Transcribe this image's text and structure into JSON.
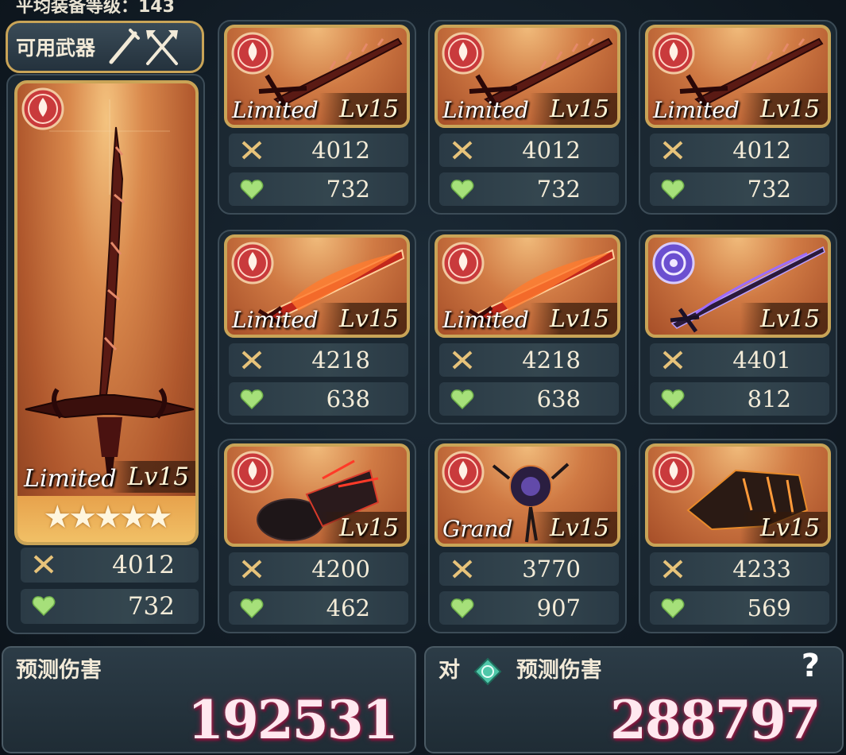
{
  "top_title": "平均装备等级：143",
  "header": {
    "label": "可用武器",
    "icons": [
      "sword-icon",
      "crossed-spears-icon"
    ]
  },
  "selected_weapon": {
    "tag": "Limited",
    "level": "Lv15",
    "stars": "★★★★★",
    "rarity_stars": 5,
    "attack": "4012",
    "hp": "732",
    "element": "fire"
  },
  "weapons": [
    {
      "tag": "Limited",
      "level": "Lv15",
      "attack": "4012",
      "hp": "732",
      "element": "fire",
      "art": "dark-spiked-sword"
    },
    {
      "tag": "Limited",
      "level": "Lv15",
      "attack": "4012",
      "hp": "732",
      "element": "fire",
      "art": "dark-spiked-sword"
    },
    {
      "tag": "Limited",
      "level": "Lv15",
      "attack": "4012",
      "hp": "732",
      "element": "fire",
      "art": "dark-spiked-sword"
    },
    {
      "tag": "Limited",
      "level": "Lv15",
      "attack": "4218",
      "hp": "638",
      "element": "fire",
      "art": "flame-sword"
    },
    {
      "tag": "Limited",
      "level": "Lv15",
      "attack": "4218",
      "hp": "638",
      "element": "fire",
      "art": "flame-sword"
    },
    {
      "tag": "",
      "level": "Lv15",
      "attack": "4401",
      "hp": "812",
      "element": "dark",
      "art": "thorn-sword"
    },
    {
      "tag": "",
      "level": "Lv15",
      "attack": "4200",
      "hp": "462",
      "element": "fire",
      "art": "dark-gauntlet"
    },
    {
      "tag": "Grand",
      "level": "Lv15",
      "attack": "3770",
      "hp": "907",
      "element": "fire",
      "art": "dark-orb"
    },
    {
      "tag": "",
      "level": "Lv15",
      "attack": "4233",
      "hp": "569",
      "element": "fire",
      "art": "lava-gauntlet"
    }
  ],
  "damage": {
    "predicted_label": "预测伤害",
    "predicted_value": "192531",
    "versus_prefix": "对",
    "versus_label": "预测伤害",
    "versus_value": "288797",
    "help": "?"
  },
  "colors": {
    "gold_frame": "#c9a457",
    "fire_badge": "#d8464a",
    "dark_badge": "#7a5cd6",
    "damage_glow": "#b4315a",
    "wind_gem": "#4fc7a9"
  }
}
